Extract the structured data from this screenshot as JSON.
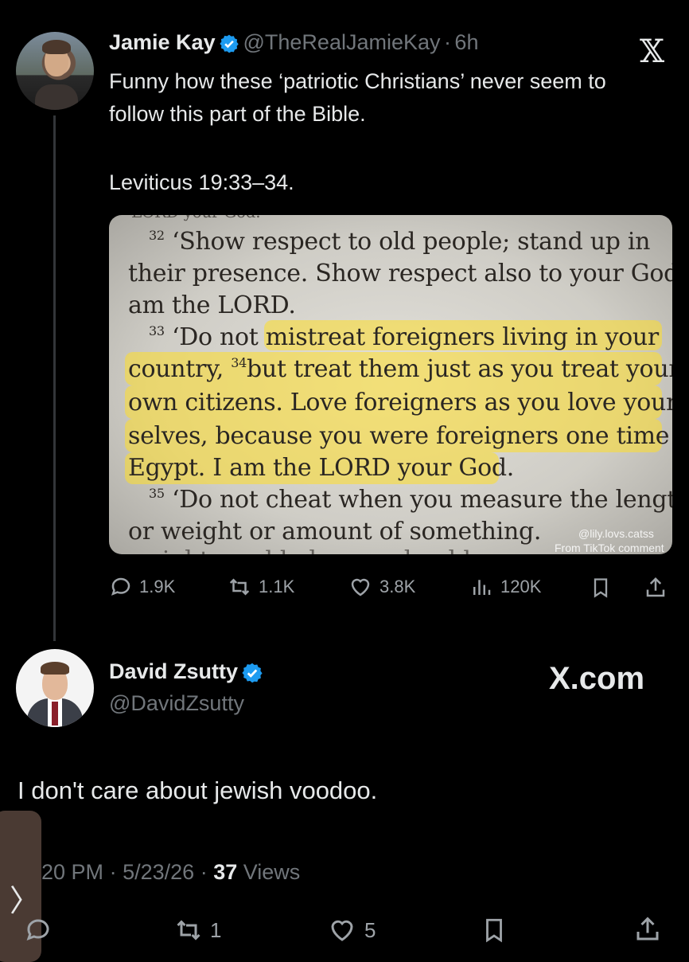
{
  "tweet1": {
    "author_name": "Jamie Kay",
    "author_handle": "@TheRealJamieKay",
    "separator": "·",
    "time": "6h",
    "text_line1": "Funny how these ‘patriotic Christians’ never seem to follow this part of the Bible.",
    "text_line2": "Leviticus 19:33–34.",
    "image_text": {
      "top_cut": "LORD your God.",
      "v32_num": "32",
      "v32_a": "‘Show respect to old people; stand up in",
      "v32_b": "their presence. Show respect also to your God. I",
      "v32_c": "am the LORD.",
      "v33_num": "33",
      "v33_a": "‘Do not mistreat foreigners living in your",
      "v33_b_pre": "country,",
      "v34_num": "34",
      "v33_b_post": "but treat them just as you treat your",
      "v33_c": "own citizens. Love foreigners as you love your-",
      "v33_d": "selves, because you were foreigners one time in",
      "v33_e": "Egypt. I am the LORD your God.",
      "v35_num": "35",
      "v35_a": "‘Do not cheat when you measure the length",
      "v35_b": "or weight or amount of something.",
      "v35_c": "weights and balances should",
      "watermark1": "@lily.lovs.catss",
      "watermark2": "From TikTok comment"
    },
    "stats": {
      "replies": "1.9K",
      "reposts": "1.1K",
      "likes": "3.8K",
      "views": "120K"
    }
  },
  "tweet2": {
    "author_name": "David Zsutty",
    "author_handle": "@DavidZsutty",
    "brand": "X.com",
    "text": "I don't care about jewish voodoo.",
    "time": "20 PM",
    "date": "5/23/26",
    "views_count": "37",
    "views_label": "Views",
    "separator": "·",
    "reposts": "1",
    "likes": "5"
  },
  "colors": {
    "background": "#000000",
    "text": "#e7e9ea",
    "muted": "#71767b",
    "verified": "#1d9bf0",
    "highlight": "#ffde28"
  },
  "icons": [
    "verified-badge-icon",
    "x-logo-icon",
    "reply-icon",
    "repost-icon",
    "like-icon",
    "views-icon",
    "bookmark-icon",
    "share-icon",
    "chevron-right-icon"
  ]
}
